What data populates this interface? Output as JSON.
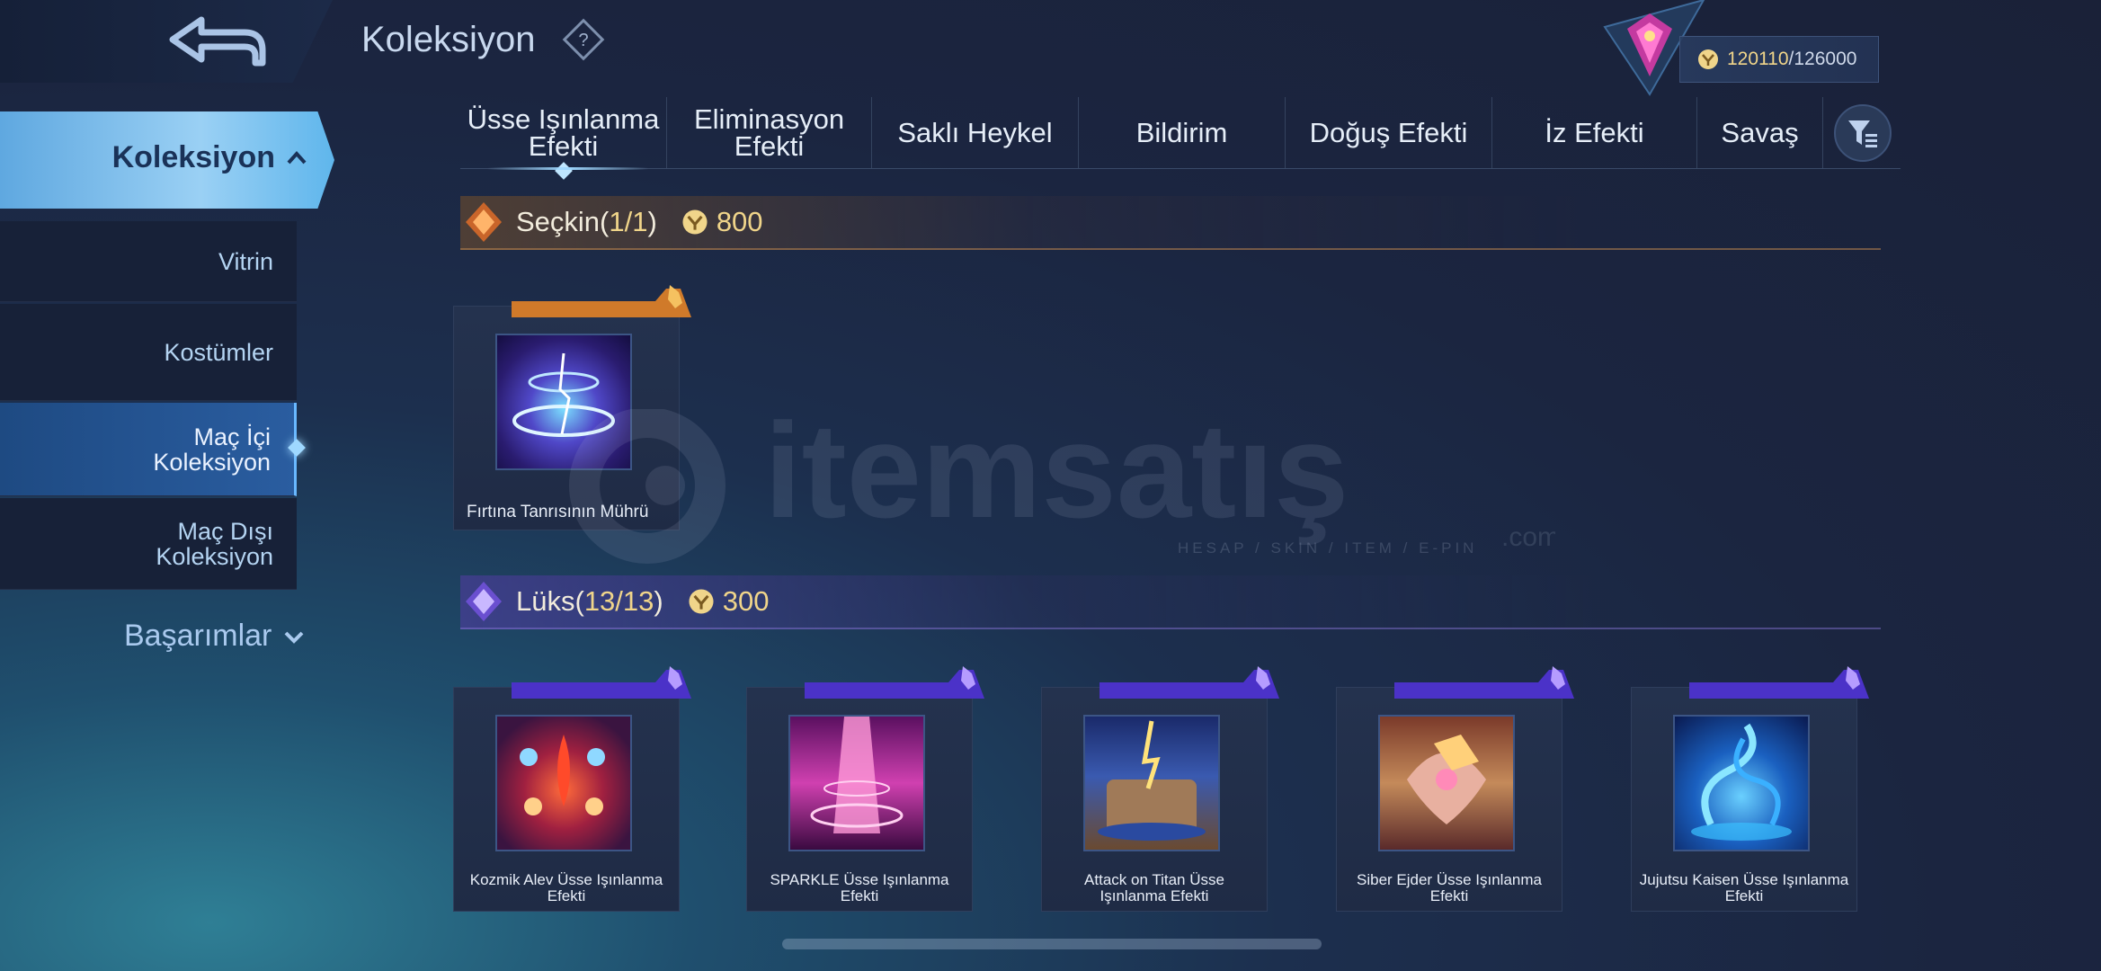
{
  "header": {
    "title": "Koleksiyon",
    "currency_current": "120110",
    "currency_max": "/126000"
  },
  "sidebar": {
    "main": "Koleksiyon",
    "items": [
      "Vitrin",
      "Kostümler",
      "Maç İçi Koleksiyon",
      "Maç Dışı Koleksiyon"
    ],
    "achievements": "Başarımlar"
  },
  "tabs": [
    "Üsse Işınlanma Efekti",
    "Eliminasyon Efekti",
    "Saklı Heykel",
    "Bildirim",
    "Doğuş Efekti",
    "İz Efekti",
    "Savaş"
  ],
  "sections": {
    "elite": {
      "title": "Seçkin",
      "count_open": "(",
      "count_cur": "1/1",
      "count_close": ")",
      "cost": "800"
    },
    "luxury": {
      "title": "Lüks",
      "count_open": "(",
      "count_cur": "13/13",
      "count_close": ")",
      "cost": "300"
    }
  },
  "elite_items": [
    {
      "name": "Fırtına Tanrısının Mührü"
    }
  ],
  "luxury_items": [
    {
      "name": "Kozmik Alev Üsse Işınlanma Efekti"
    },
    {
      "name": "SPARKLE Üsse Işınlanma Efekti"
    },
    {
      "name": "Attack on Titan Üsse Işınlanma Efekti"
    },
    {
      "name": "Siber Ejder Üsse Işınlanma Efekti"
    },
    {
      "name": "Jujutsu Kaisen Üsse Işınlanma Efekti"
    }
  ],
  "watermark": {
    "brand": "itemsatış",
    "tagline": "HESAP / SKIN / ITEM / E-PIN",
    "domain": ".com"
  },
  "colors": {
    "accent": "#9fd8ff",
    "gold": "#f0d58a",
    "luxury_purple": "#6a4fd0"
  }
}
